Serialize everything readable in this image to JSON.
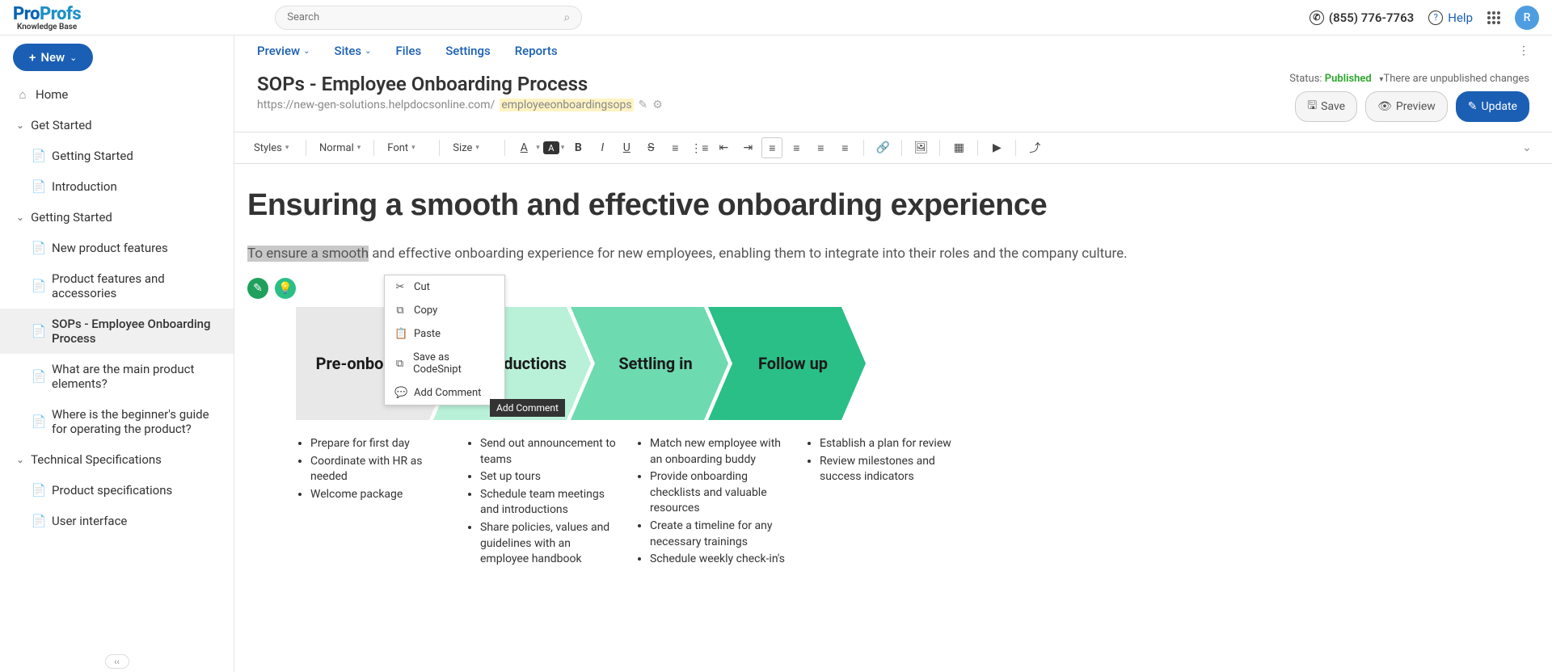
{
  "header": {
    "logo_pro": "Pro",
    "logo_profs": "Profs",
    "logo_sub": "Knowledge Base",
    "search_placeholder": "Search",
    "phone": "(855) 776-7763",
    "help": "Help",
    "avatar_initial": "R"
  },
  "sidebar": {
    "new_btn": "New",
    "items": [
      {
        "label": "Home",
        "type": "home"
      },
      {
        "label": "Get Started",
        "type": "folder"
      },
      {
        "label": "Getting Started",
        "type": "page",
        "level": 1
      },
      {
        "label": "Introduction",
        "type": "page",
        "level": 1
      },
      {
        "label": "Getting Started",
        "type": "folder"
      },
      {
        "label": "New product features",
        "type": "page",
        "level": 1
      },
      {
        "label": "Product features and accessories",
        "type": "page",
        "level": 1
      },
      {
        "label": "SOPs - Employee Onboarding Process",
        "type": "page",
        "level": 1,
        "active": true
      },
      {
        "label": "What are the main product elements?",
        "type": "page",
        "level": 1
      },
      {
        "label": "Where is the beginner's guide for operating the product?",
        "type": "page",
        "level": 1
      },
      {
        "label": "Technical Specifications",
        "type": "folder"
      },
      {
        "label": "Product specifications",
        "type": "page",
        "level": 1
      },
      {
        "label": "User interface",
        "type": "page",
        "level": 1
      }
    ]
  },
  "topnav": {
    "items": [
      "Preview",
      "Sites",
      "Files",
      "Settings",
      "Reports"
    ],
    "dropdowns": [
      true,
      true,
      false,
      false,
      false
    ]
  },
  "doc": {
    "title": "SOPs - Employee Onboarding Process",
    "url_prefix": "https://new-gen-solutions.helpdocsonline.com/",
    "url_slug": "employeeonboardingsops",
    "status_label": "Status:",
    "status_value": "Published",
    "unpublished_note": "There are unpublished changes",
    "save": "Save",
    "preview": "Preview",
    "update": "Update"
  },
  "toolbar": {
    "styles": "Styles",
    "format": "Normal",
    "font": "Font",
    "size": "Size"
  },
  "editor": {
    "heading": "Ensuring a smooth and effective onboarding experience",
    "intro_selected": "To ensure a smooth",
    "intro_rest": " and effective onboarding experience for new employees, enabling them to integrate into their roles and the company culture."
  },
  "context_menu": {
    "items": [
      "Cut",
      "Copy",
      "Paste",
      "Save as CodeSnipt",
      "Add Comment"
    ],
    "tooltip": "Add Comment"
  },
  "chevrons": [
    {
      "label": "Pre-onboarding",
      "fill": "#e8e8e8"
    },
    {
      "label": "Introductions",
      "fill": "#b8f0d8"
    },
    {
      "label": "Settling in",
      "fill": "#6ddab0"
    },
    {
      "label": "Follow up",
      "fill": "#2bbf88"
    }
  ],
  "bullets": [
    [
      "Prepare for first day",
      "Coordinate with HR as needed",
      "Welcome package"
    ],
    [
      "Send out announcement to teams",
      "Set up tours",
      "Schedule team meetings and introductions",
      "Share policies, values and guidelines with an employee handbook"
    ],
    [
      "Match new employee with an onboarding buddy",
      "Provide onboarding checklists and valuable resources",
      "Create a timeline for any necessary trainings",
      "Schedule weekly check-in's"
    ],
    [
      "Establish a plan for review",
      "Review milestones and success indicators"
    ]
  ]
}
